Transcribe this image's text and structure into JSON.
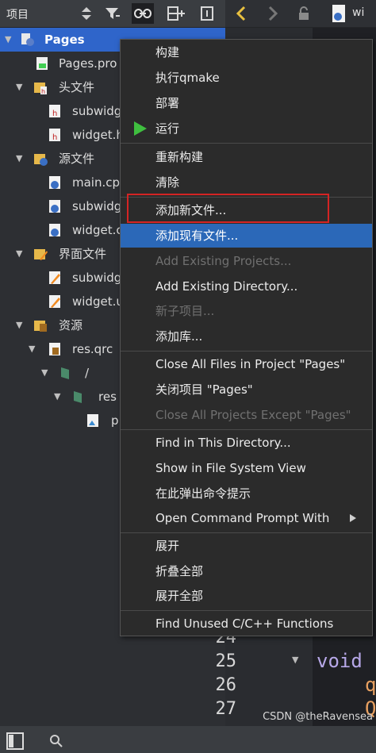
{
  "toolbar": {
    "title": "项目"
  },
  "editor": {
    "tab_label": "wi",
    "lines": [
      {
        "num": "24",
        "code": ""
      },
      {
        "num": "25",
        "code": "void"
      },
      {
        "num": "26",
        "code": "q"
      },
      {
        "num": "27",
        "code": "Q"
      }
    ]
  },
  "tree": {
    "items": [
      {
        "label": "Pages"
      },
      {
        "label": "Pages.pro"
      },
      {
        "label": "头文件"
      },
      {
        "label": "subwidg"
      },
      {
        "label": "widget.h"
      },
      {
        "label": "源文件"
      },
      {
        "label": "main.cpp"
      },
      {
        "label": "subwidg"
      },
      {
        "label": "widget.c"
      },
      {
        "label": "界面文件"
      },
      {
        "label": "subwidg"
      },
      {
        "label": "widget.u"
      },
      {
        "label": "资源"
      },
      {
        "label": "res.qrc"
      },
      {
        "label": "/"
      },
      {
        "label": "res"
      },
      {
        "label": "p"
      }
    ]
  },
  "context_menu": {
    "items": [
      {
        "label": "构建"
      },
      {
        "label": "执行qmake"
      },
      {
        "label": "部署"
      },
      {
        "label": "运行"
      },
      {
        "label": "重新构建"
      },
      {
        "label": "清除"
      },
      {
        "label": "添加新文件..."
      },
      {
        "label": "添加现有文件..."
      },
      {
        "label": "Add Existing Projects..."
      },
      {
        "label": "Add Existing Directory..."
      },
      {
        "label": "新子项目..."
      },
      {
        "label": "添加库..."
      },
      {
        "label": "Close All Files in Project \"Pages\""
      },
      {
        "label": "关闭项目 \"Pages\""
      },
      {
        "label": "Close All Projects Except \"Pages\""
      },
      {
        "label": "Find in This Directory..."
      },
      {
        "label": "Show in File System View"
      },
      {
        "label": "在此弹出命令提示"
      },
      {
        "label": "Open Command Prompt With"
      },
      {
        "label": "展开"
      },
      {
        "label": "折叠全部"
      },
      {
        "label": "展开全部"
      },
      {
        "label": "Find Unused C/C++ Functions"
      }
    ]
  },
  "status": {
    "watermark": "CSDN @theRavensea"
  },
  "colors": {
    "selection": "#2f65ca",
    "highlight": "#2b68b8",
    "run_icon": "#3fbf3f",
    "annotation": "#d42424"
  }
}
